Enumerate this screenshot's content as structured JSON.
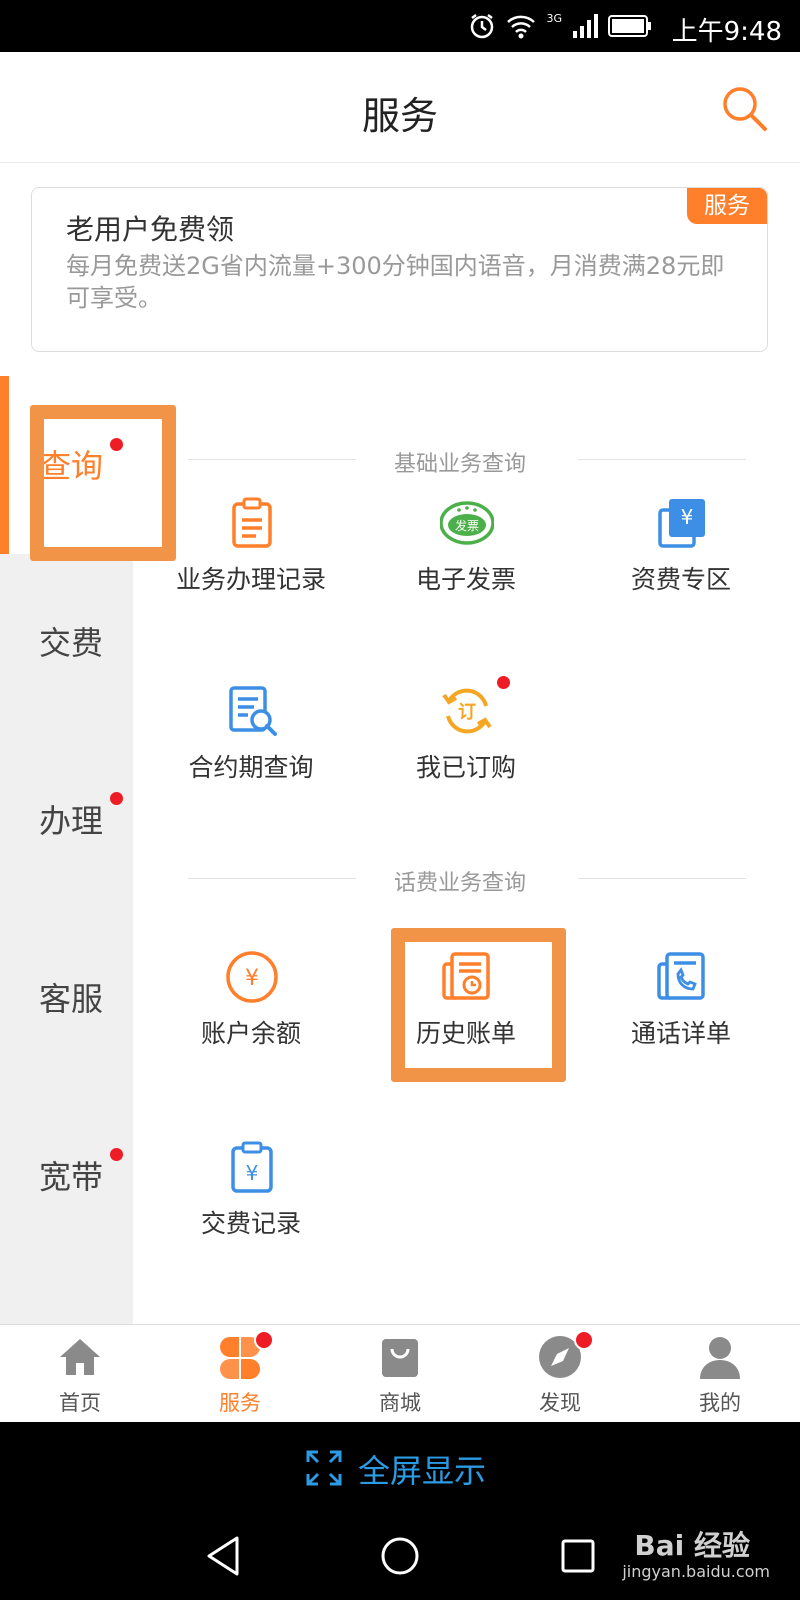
{
  "status_bar": {
    "time": "上午9:48",
    "network": "3G"
  },
  "header": {
    "title": "服务"
  },
  "promo": {
    "title": "老用户免费领",
    "description": "每月免费送2G省内流量+300分钟国内语音，月消费满28元即可享受。",
    "tag": "服务"
  },
  "sidebar": {
    "items": [
      {
        "label": "查询",
        "active": true,
        "dot": true
      },
      {
        "label": "交费",
        "active": false,
        "dot": false
      },
      {
        "label": "办理",
        "active": false,
        "dot": true
      },
      {
        "label": "客服",
        "active": false,
        "dot": false
      },
      {
        "label": "宽带",
        "active": false,
        "dot": true
      }
    ]
  },
  "sections": [
    {
      "title": "基础业务查询",
      "items": [
        {
          "label": "业务办理记录",
          "icon": "clipboard-list-icon"
        },
        {
          "label": "电子发票",
          "icon": "invoice-badge-icon",
          "icon_text": "发票"
        },
        {
          "label": "资费专区",
          "icon": "yuan-documents-icon",
          "icon_text": "¥"
        },
        {
          "label": "合约期查询",
          "icon": "document-search-icon"
        },
        {
          "label": "我已订购",
          "icon": "subscription-cycle-icon",
          "icon_text": "订",
          "dot": true
        }
      ]
    },
    {
      "title": "话费业务查询",
      "items": [
        {
          "label": "账户余额",
          "icon": "yuan-circle-icon",
          "icon_text": "¥"
        },
        {
          "label": "历史账单",
          "icon": "bill-history-icon"
        },
        {
          "label": "通话详单",
          "icon": "call-detail-icon"
        },
        {
          "label": "交费记录",
          "icon": "payment-record-icon",
          "icon_text": "¥"
        }
      ]
    }
  ],
  "bottom_nav": {
    "items": [
      {
        "label": "首页",
        "icon": "home-icon"
      },
      {
        "label": "服务",
        "icon": "services-grid-icon",
        "active": true,
        "dot": true
      },
      {
        "label": "商城",
        "icon": "shopping-bag-icon"
      },
      {
        "label": "发现",
        "icon": "compass-icon",
        "dot": true
      },
      {
        "label": "我的",
        "icon": "user-icon"
      }
    ]
  },
  "fullscreen_bar": {
    "label": "全屏显示"
  },
  "watermark": {
    "brand": "Bai 经验",
    "url": "jingyan.baidu.com"
  },
  "colors": {
    "accent": "#ff7f2a",
    "highlight_box": "#f29447",
    "blue_icon": "#3d8fe6",
    "green_icon": "#4cb04a",
    "badge_dot": "#ee1c25",
    "fullscreen_text": "#2b9be4"
  }
}
